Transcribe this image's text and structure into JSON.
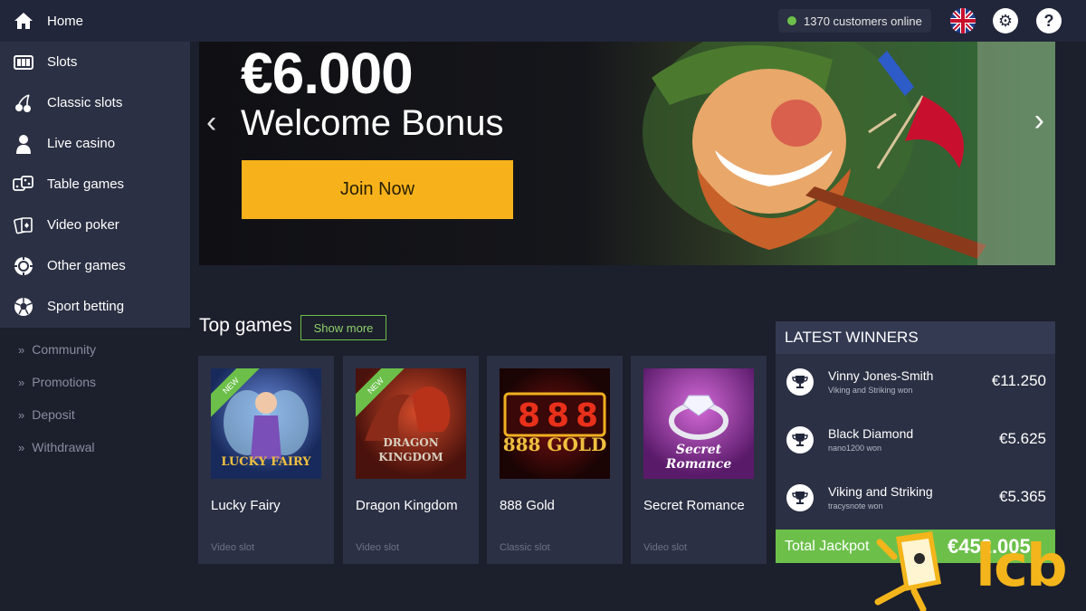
{
  "topbar": {
    "home_label": "Home",
    "online_text": "1370 customers online",
    "icons": [
      "home-icon",
      "uk-flag-icon",
      "gear-icon",
      "help-icon"
    ]
  },
  "sidebar": {
    "items": [
      {
        "label": "Slots",
        "icon": "slots-icon"
      },
      {
        "label": "Classic slots",
        "icon": "cherries-icon"
      },
      {
        "label": "Live casino",
        "icon": "dealer-icon"
      },
      {
        "label": "Table games",
        "icon": "dice-icon"
      },
      {
        "label": "Video poker",
        "icon": "cards-icon"
      },
      {
        "label": "Other games",
        "icon": "chip-icon"
      },
      {
        "label": "Sport betting",
        "icon": "football-icon"
      }
    ],
    "sublinks": [
      "Community",
      "Promotions",
      "Deposit",
      "Withdrawal"
    ]
  },
  "banner": {
    "amount": "€6.000",
    "subtitle": "Welcome Bonus",
    "button": "Join Now"
  },
  "top_games": {
    "title": "Top games",
    "show_more": "Show more",
    "games": [
      {
        "name": "Lucky Fairy",
        "type": "Video slot",
        "badge": "NEW",
        "thumb_text": "LUCKY FAIRY"
      },
      {
        "name": "Dragon Kingdom",
        "type": "Video slot",
        "badge": "NEW",
        "thumb_text": "DRAGON KINGDOM"
      },
      {
        "name": "888 Gold",
        "type": "Classic slot",
        "badge": "",
        "thumb_text": "888 GOLD"
      },
      {
        "name": "Secret Romance",
        "type": "Video slot",
        "badge": "",
        "thumb_text": "Secret Romance"
      }
    ]
  },
  "winners": {
    "title": "LATEST WINNERS",
    "rows": [
      {
        "name": "Vinny Jones-Smith",
        "game": "Viking and Striking won",
        "amount": "€11.250"
      },
      {
        "name": "Black Diamond",
        "game": "nano1200 won",
        "amount": "€5.625"
      },
      {
        "name": "Viking and Striking",
        "game": "tracysnote won",
        "amount": "€5.365"
      }
    ],
    "jackpot_label": "Total Jackpot",
    "jackpot_value": "€452.005"
  },
  "watermark": "lcb",
  "colors": {
    "accent_green": "#6cc04a",
    "button_yellow": "#f7b21b",
    "panel": "#2b3044"
  }
}
